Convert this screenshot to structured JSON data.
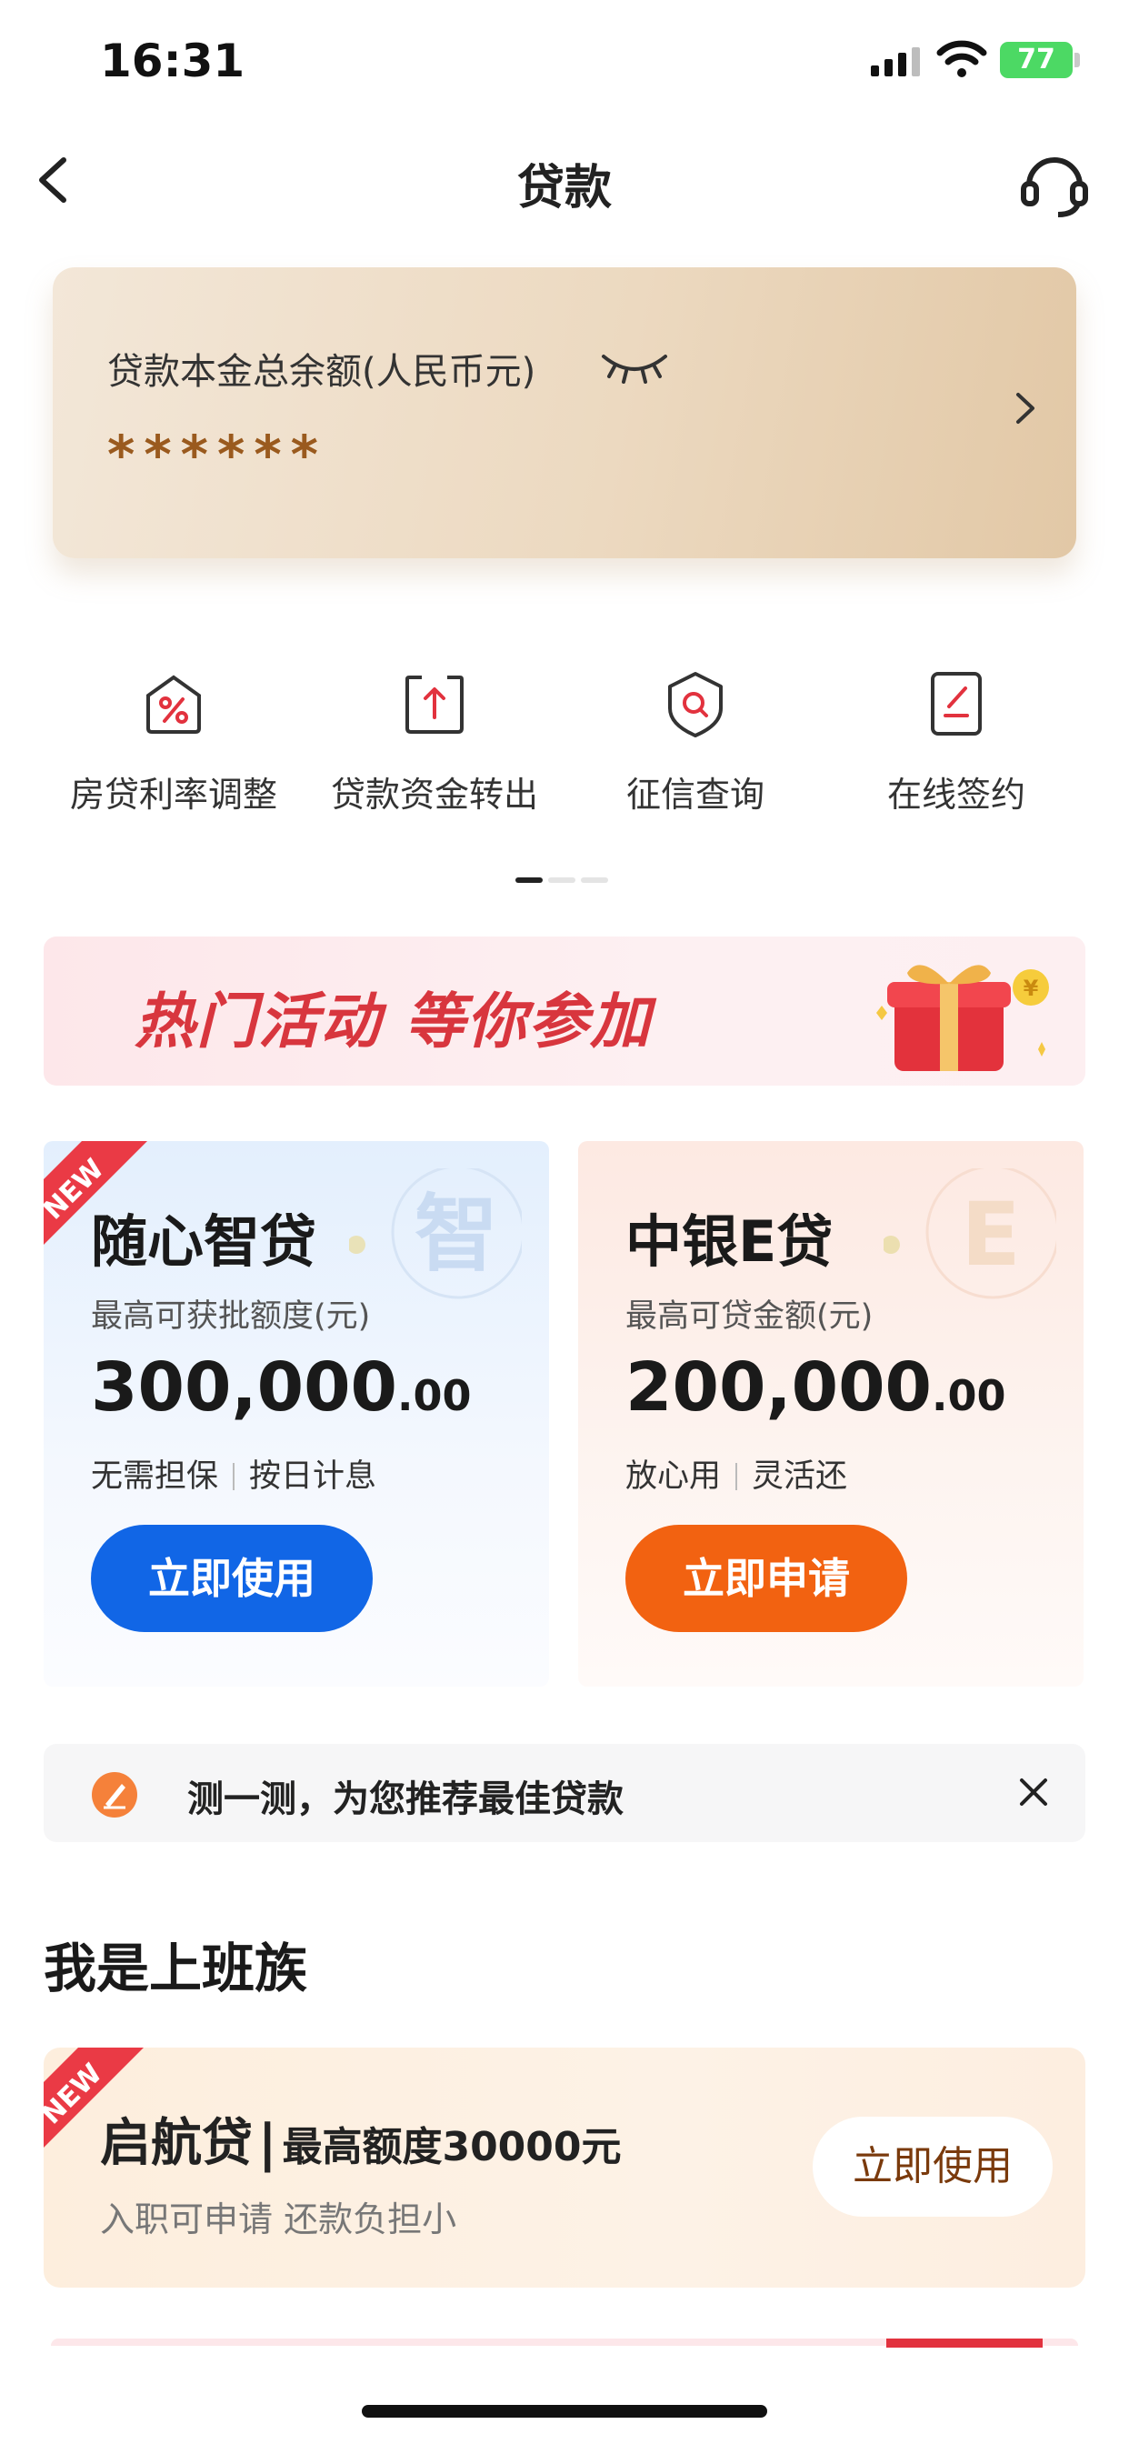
{
  "status_bar": {
    "time": "16:31",
    "battery": "77"
  },
  "nav": {
    "title": "贷款"
  },
  "balance_card": {
    "label": "贷款本金总余额(人民币元)",
    "value": "******"
  },
  "quick_actions": [
    {
      "label": "房贷利率调整",
      "icon": "percent-house-icon"
    },
    {
      "label": "贷款资金转出",
      "icon": "transfer-out-icon"
    },
    {
      "label": "征信查询",
      "icon": "credit-search-icon"
    },
    {
      "label": "在线签约",
      "icon": "sign-document-icon"
    }
  ],
  "banner": {
    "text": "热门活动 等你参加"
  },
  "products": [
    {
      "badge": "NEW",
      "title": "随心智贷",
      "subtitle": "最高可获批额度(元)",
      "amount": "300,000",
      "decimals": ".00",
      "tag1": "无需担保",
      "tag2": "按日计息",
      "button": "立即使用",
      "deco_char": "智",
      "accent": "#1166e6"
    },
    {
      "badge": "",
      "title": "中银E贷",
      "subtitle": "最高可贷金额(元)",
      "amount": "200,000",
      "decimals": ".00",
      "tag1": "放心用",
      "tag2": "灵活还",
      "button": "立即申请",
      "deco_char": "E",
      "accent": "#f26211"
    }
  ],
  "recommend": {
    "text": "测一测，为您推荐最佳贷款"
  },
  "section": {
    "title": "我是上班族"
  },
  "promo": {
    "badge": "NEW",
    "name": "启航贷",
    "separator": "|",
    "detail": "最高额度30000元",
    "subtitle": "入职可申请 还款负担小",
    "button": "立即使用"
  }
}
